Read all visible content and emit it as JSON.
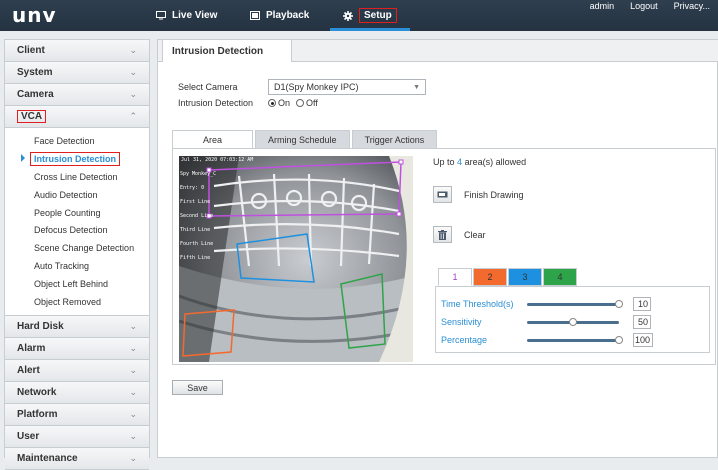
{
  "brand": {
    "logo": "unv",
    "accent": "#2a8fd6"
  },
  "topnav": {
    "items": [
      {
        "label": "Live View",
        "icon": "monitor-icon"
      },
      {
        "label": "Playback",
        "icon": "film-icon"
      },
      {
        "label": "Setup",
        "icon": "gear-icon"
      }
    ],
    "links": [
      "admin",
      "Logout",
      "Privacy..."
    ]
  },
  "sidebar": {
    "sections": [
      {
        "label": "Client"
      },
      {
        "label": "System"
      },
      {
        "label": "Camera"
      },
      {
        "label": "VCA"
      },
      {
        "label": "Hard Disk"
      },
      {
        "label": "Alarm"
      },
      {
        "label": "Alert"
      },
      {
        "label": "Network"
      },
      {
        "label": "Platform"
      },
      {
        "label": "User"
      },
      {
        "label": "Maintenance"
      }
    ],
    "vca_items": [
      "Face Detection",
      "Intrusion Detection",
      "Cross Line Detection",
      "Audio Detection",
      "People Counting",
      "Defocus Detection",
      "Scene Change Detection",
      "Auto Tracking",
      "Object Left Behind",
      "Object Removed"
    ],
    "active_item": "Intrusion Detection"
  },
  "main": {
    "tab_title": "Intrusion Detection",
    "select_camera_label": "Select Camera",
    "select_camera_value": "D1(Spy Monkey IPC)",
    "intrusion_label": "Intrusion Detection",
    "on_label": "On",
    "off_label": "Off",
    "subtabs": [
      "Area",
      "Arming Schedule",
      "Trigger Actions"
    ],
    "allowed_prefix": "Up to",
    "allowed_count": "4",
    "allowed_suffix": "area(s) allowed",
    "finish_drawing": "Finish Drawing",
    "clear": "Clear",
    "area_tabs": [
      {
        "label": "1",
        "color": "#ffffff",
        "text": "#a040c0"
      },
      {
        "label": "2",
        "color": "#f26a2e",
        "text": "#333333"
      },
      {
        "label": "3",
        "color": "#1e90e0",
        "text": "#333333"
      },
      {
        "label": "4",
        "color": "#2ea44a",
        "text": "#333333"
      }
    ],
    "sliders": [
      {
        "label": "Time Threshold(s)",
        "value": "10",
        "level": 1.0
      },
      {
        "label": "Sensitivity",
        "value": "50",
        "level": 0.5
      },
      {
        "label": "Percentage",
        "value": "100",
        "level": 1.0
      }
    ],
    "save_label": "Save"
  },
  "video": {
    "timestamp": "Jul 31, 2020 07:03:12 AM",
    "osd_lines": [
      "Spy Monkey_C",
      "Entry: 0",
      "First Line",
      "Second Line",
      "Third Line",
      "Fourth Line",
      "Fifth Line"
    ]
  }
}
